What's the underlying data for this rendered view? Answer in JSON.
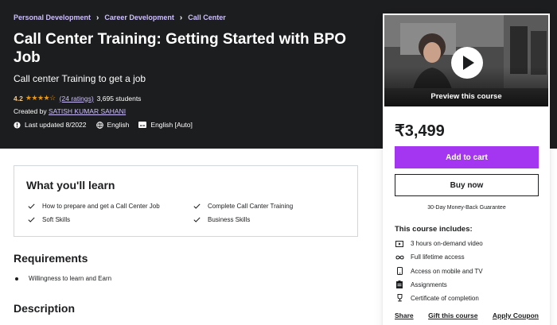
{
  "breadcrumbs": [
    "Personal Development",
    "Career Development",
    "Call Center"
  ],
  "course": {
    "title": "Call Center Training: Getting Started with BPO Job",
    "subtitle": "Call center Training to get a job",
    "rating": "4.2",
    "stars": "★★★★☆",
    "ratings_count": "(24 ratings)",
    "students": "3,695 students",
    "created_by_label": "Created by",
    "instructor": "SATISH KUMAR SAHANI",
    "last_updated": "Last updated 8/2022",
    "language": "English",
    "captions": "English [Auto]"
  },
  "sidebar": {
    "preview_label": "Preview this course",
    "price": "₹3,499",
    "add_to_cart": "Add to cart",
    "buy_now": "Buy now",
    "guarantee": "30-Day Money-Back Guarantee",
    "includes_title": "This course includes:",
    "includes": [
      {
        "icon": "video-icon",
        "text": "3 hours on-demand video"
      },
      {
        "icon": "infinity-icon",
        "text": "Full lifetime access"
      },
      {
        "icon": "mobile-icon",
        "text": "Access on mobile and TV"
      },
      {
        "icon": "assignment-icon",
        "text": "Assignments"
      },
      {
        "icon": "trophy-icon",
        "text": "Certificate of completion"
      }
    ],
    "share": "Share",
    "gift": "Gift this course",
    "coupon": "Apply Coupon"
  },
  "learn": {
    "title": "What you'll learn",
    "items": [
      "How to prepare and get a Call Center Job",
      "Complete Call Canter Training",
      "Soft Skills",
      "Business Skills"
    ]
  },
  "requirements": {
    "title": "Requirements",
    "items": [
      "Willingness to learn and Earn"
    ]
  },
  "description": {
    "title": "Description"
  },
  "colors": {
    "hero_bg": "#1c1d1f",
    "accent_purple": "#a435f0",
    "link_lavender": "#cec0fc",
    "rating_gold": "#f3ca8c",
    "star_orange": "#e59819"
  }
}
